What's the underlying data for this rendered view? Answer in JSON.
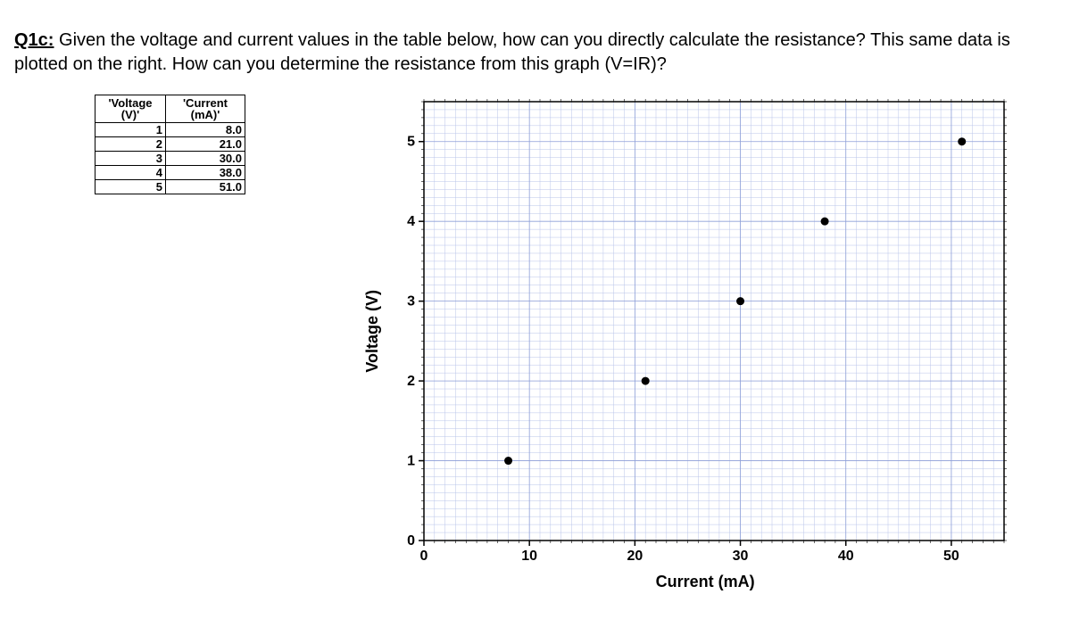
{
  "question": {
    "label": "Q1c:",
    "text": "Given the voltage and current values in the table below, how can you directly calculate the resistance? This same data is plotted on the right. How can you determine the resistance from this graph (V=IR)?"
  },
  "table": {
    "headers": {
      "voltage": "'Voltage (V)'",
      "current": "'Current (mA)'"
    },
    "rows": [
      {
        "v": "1",
        "i": "8.0"
      },
      {
        "v": "2",
        "i": "21.0"
      },
      {
        "v": "3",
        "i": "30.0"
      },
      {
        "v": "4",
        "i": "38.0"
      },
      {
        "v": "5",
        "i": "51.0"
      }
    ]
  },
  "chart_data": {
    "type": "scatter",
    "x": [
      8.0,
      21.0,
      30.0,
      38.0,
      51.0
    ],
    "y": [
      1,
      2,
      3,
      4,
      5
    ],
    "xlabel": "Current (mA)",
    "ylabel": "Voltage (V)",
    "xlim": [
      0,
      55
    ],
    "ylim": [
      0,
      5.5
    ],
    "xticks": [
      0,
      10,
      20,
      30,
      40,
      50
    ],
    "yticks": [
      0,
      1,
      2,
      3,
      4,
      5
    ],
    "x_minor_step": 1,
    "y_minor_step": 0.1,
    "grid": true
  }
}
